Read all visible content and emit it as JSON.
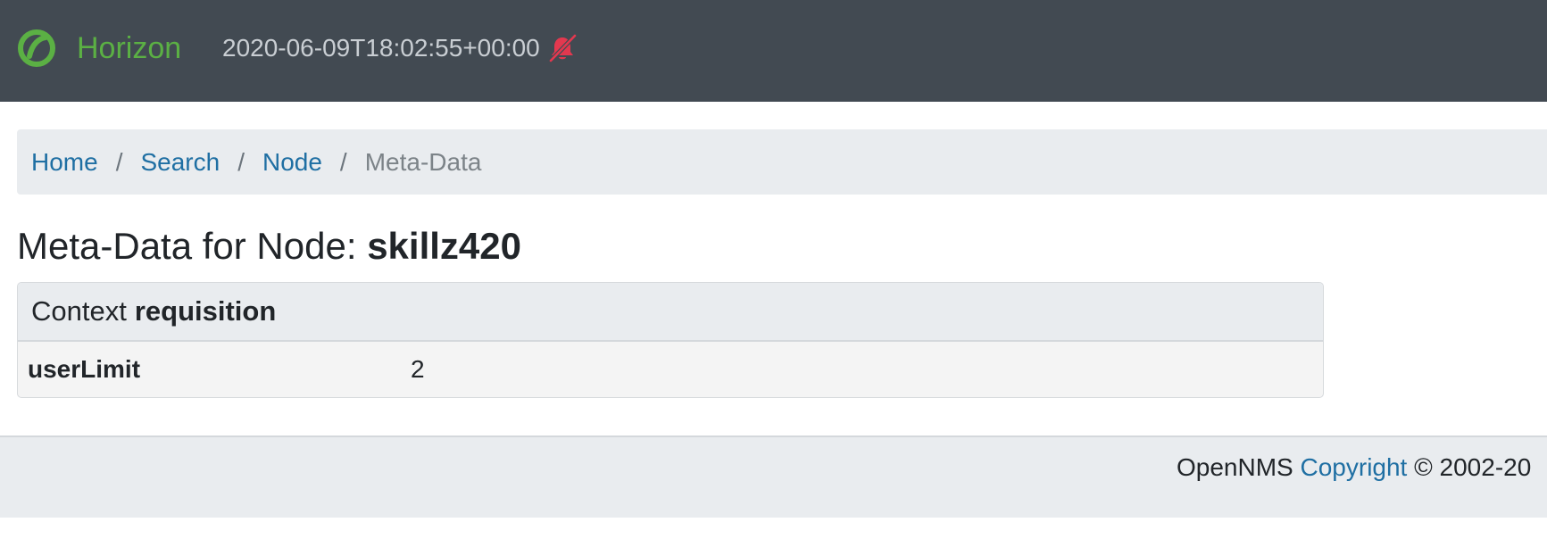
{
  "navbar": {
    "brand_name": "Horizon",
    "logo_icon": "opennms-logo-icon",
    "server_time": "2020-06-09T18:02:55+00:00",
    "notification_icon": "bell-slash-icon",
    "colors": {
      "background": "#424a52",
      "brand": "#5bb044",
      "notification_muted": "#e3384f"
    }
  },
  "breadcrumb": {
    "items": [
      {
        "label": "Home",
        "link": true
      },
      {
        "label": "Search",
        "link": true
      },
      {
        "label": "Node",
        "link": true
      },
      {
        "label": "Meta-Data",
        "link": false
      }
    ],
    "separator": "/"
  },
  "page": {
    "title_prefix": "Meta-Data for Node:",
    "node_label": "skillz420"
  },
  "context_card": {
    "header_prefix": "Context",
    "context_name": "requisition",
    "rows": [
      {
        "key": "userLimit",
        "value": "2"
      }
    ]
  },
  "footer": {
    "prefix": "OpenNMS",
    "link_label": "Copyright",
    "suffix": "© 2002-20"
  }
}
